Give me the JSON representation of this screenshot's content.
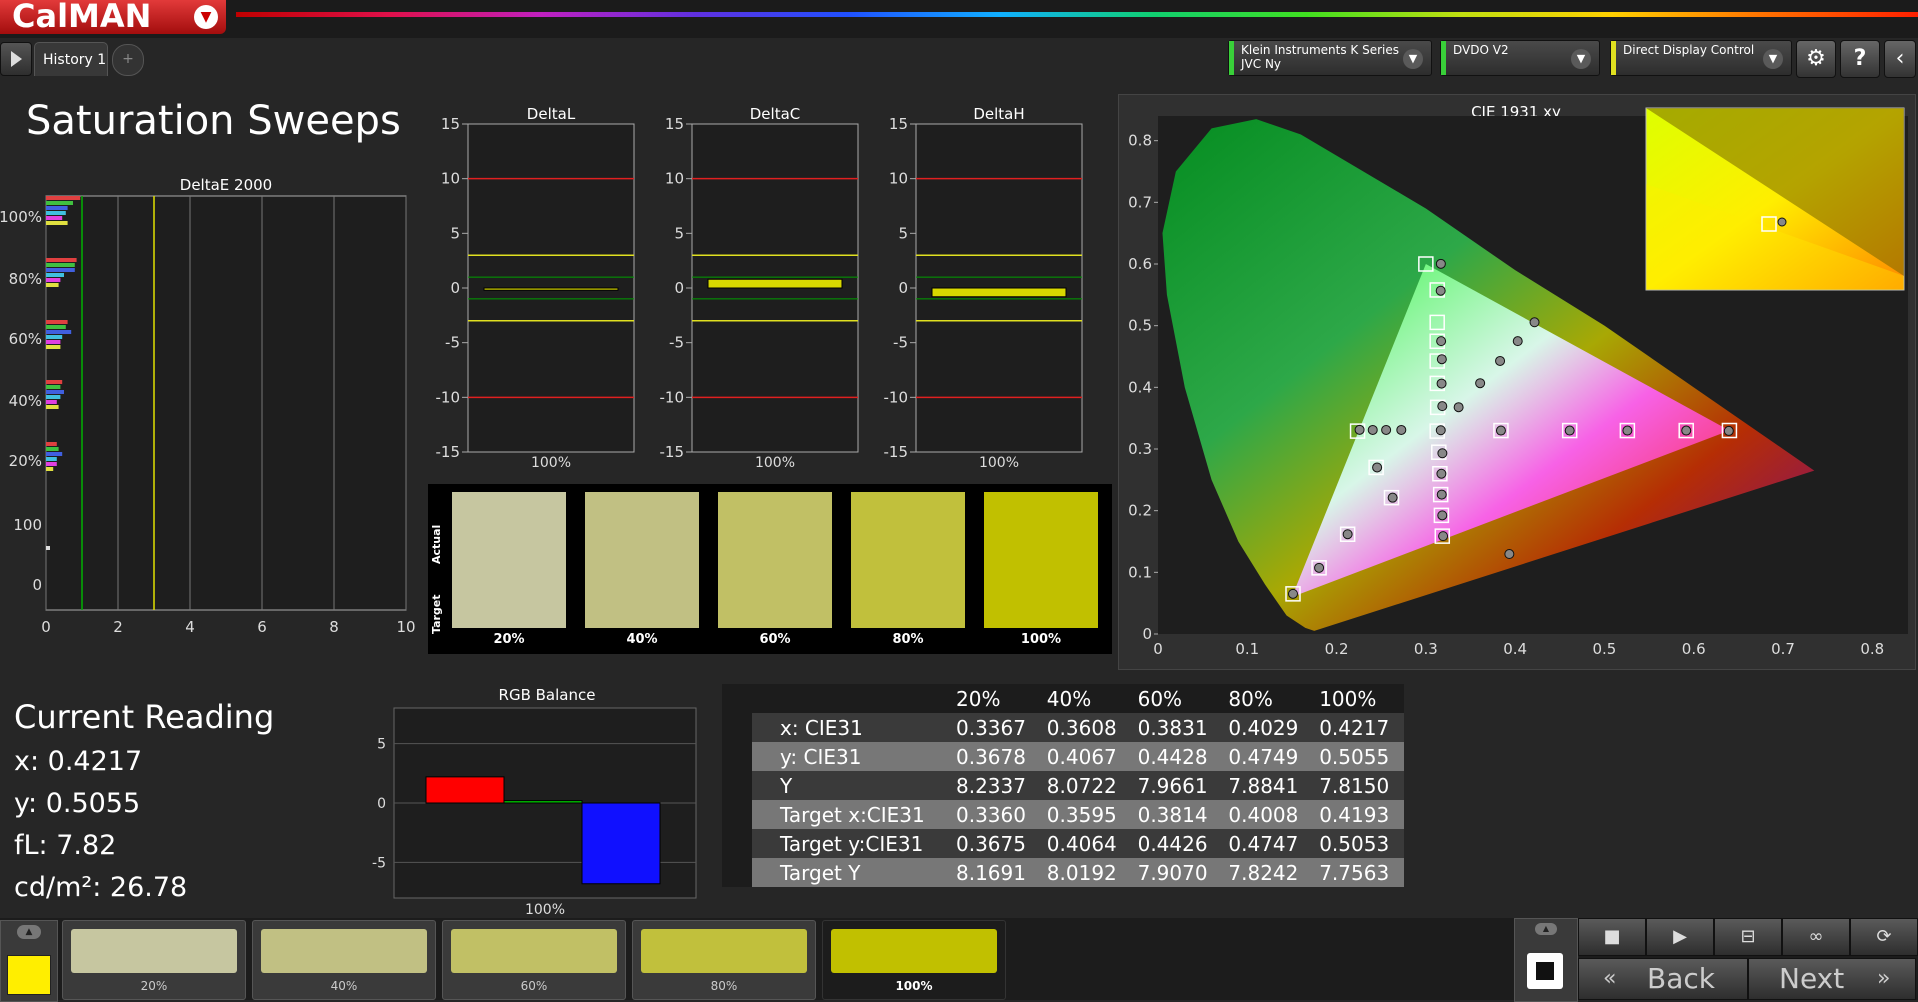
{
  "app": {
    "logo_text": "CalMAN",
    "logo_arrow": "▼"
  },
  "tabs": {
    "history_label": "History 1",
    "add_label": "+"
  },
  "devices": [
    {
      "line1": "Klein Instruments K Series",
      "line2": "JVC Ny",
      "color": "#39d039"
    },
    {
      "line1": "DVDO V2",
      "line2": "",
      "color": "#39d039"
    },
    {
      "line1": "Direct Display Control",
      "line2": "",
      "color": "#e0e020"
    }
  ],
  "toolbar_icons": [
    "gear-icon",
    "help-icon",
    "collapse-icon"
  ],
  "page_title": "Saturation Sweeps",
  "deltae_chart": {
    "title": "DeltaE 2000",
    "xticks": [
      "0",
      "2",
      "4",
      "6",
      "8",
      "10"
    ],
    "yticks": [
      "100%",
      "80%",
      "60%",
      "40%",
      "20%",
      "100",
      "0"
    ],
    "thresholds": [
      1,
      3
    ],
    "threshold_colors": [
      "#00b000",
      "#e0e000"
    ],
    "groups": [
      {
        "label": "100%",
        "bars": [
          {
            "v": 0.95,
            "c": "#e04040"
          },
          {
            "v": 0.75,
            "c": "#40c040"
          },
          {
            "v": 0.6,
            "c": "#4060e0"
          },
          {
            "v": 0.55,
            "c": "#40c0e0"
          },
          {
            "v": 0.45,
            "c": "#e040e0"
          },
          {
            "v": 0.6,
            "c": "#e0e040"
          }
        ]
      },
      {
        "label": "80%",
        "bars": [
          {
            "v": 0.85,
            "c": "#e04040"
          },
          {
            "v": 0.8,
            "c": "#40c040"
          },
          {
            "v": 0.8,
            "c": "#4060e0"
          },
          {
            "v": 0.5,
            "c": "#40c0e0"
          },
          {
            "v": 0.4,
            "c": "#e040e0"
          },
          {
            "v": 0.35,
            "c": "#e0e040"
          }
        ]
      },
      {
        "label": "60%",
        "bars": [
          {
            "v": 0.6,
            "c": "#e04040"
          },
          {
            "v": 0.55,
            "c": "#40c040"
          },
          {
            "v": 0.7,
            "c": "#4060e0"
          },
          {
            "v": 0.45,
            "c": "#40c0e0"
          },
          {
            "v": 0.4,
            "c": "#e040e0"
          },
          {
            "v": 0.4,
            "c": "#e0e040"
          }
        ]
      },
      {
        "label": "40%",
        "bars": [
          {
            "v": 0.45,
            "c": "#e04040"
          },
          {
            "v": 0.4,
            "c": "#40c040"
          },
          {
            "v": 0.5,
            "c": "#4060e0"
          },
          {
            "v": 0.4,
            "c": "#40c0e0"
          },
          {
            "v": 0.3,
            "c": "#e040e0"
          },
          {
            "v": 0.35,
            "c": "#e0e040"
          }
        ]
      },
      {
        "label": "20%",
        "bars": [
          {
            "v": 0.3,
            "c": "#e04040"
          },
          {
            "v": 0.35,
            "c": "#40c040"
          },
          {
            "v": 0.45,
            "c": "#4060e0"
          },
          {
            "v": 0.3,
            "c": "#40c0e0"
          },
          {
            "v": 0.3,
            "c": "#e040e0"
          },
          {
            "v": 0.2,
            "c": "#e0e040"
          }
        ]
      }
    ]
  },
  "delta_charts": [
    {
      "title": "DeltaL",
      "xlabel": "100%",
      "value": -0.2,
      "yticks": [
        "15",
        "10",
        "5",
        "0",
        "-5",
        "-10",
        "-15"
      ]
    },
    {
      "title": "DeltaC",
      "xlabel": "100%",
      "value": 0.8,
      "yticks": [
        "15",
        "10",
        "5",
        "0",
        "-5",
        "-10",
        "-15"
      ]
    },
    {
      "title": "DeltaH",
      "xlabel": "100%",
      "value": -0.8,
      "yticks": [
        "15",
        "10",
        "5",
        "0",
        "-5",
        "-10",
        "-15"
      ]
    }
  ],
  "swatch_panel": {
    "actual_label": "Actual",
    "target_label": "Target",
    "items": [
      {
        "label": "20%",
        "color": "#c6c6a0"
      },
      {
        "label": "40%",
        "color": "#c1c083"
      },
      {
        "label": "60%",
        "color": "#c1c065"
      },
      {
        "label": "80%",
        "color": "#c1c03c"
      },
      {
        "label": "100%",
        "color": "#c1c000"
      }
    ]
  },
  "cie": {
    "title": "CIE 1931 xy",
    "xticks": [
      "0",
      "0.1",
      "0.2",
      "0.3",
      "0.4",
      "0.5",
      "0.6",
      "0.7",
      "0.8"
    ],
    "yticks": [
      "0",
      "0.1",
      "0.2",
      "0.3",
      "0.4",
      "0.5",
      "0.6",
      "0.7",
      "0.8"
    ],
    "targets": [
      [
        0.3127,
        0.329
      ],
      [
        0.2235,
        0.329
      ],
      [
        0.2443,
        0.2701
      ],
      [
        0.2615,
        0.2211
      ],
      [
        0.2124,
        0.1618
      ],
      [
        0.1804,
        0.1073
      ],
      [
        0.1512,
        0.0651
      ],
      [
        0.3145,
        0.2948
      ],
      [
        0.3157,
        0.2599
      ],
      [
        0.3166,
        0.2261
      ],
      [
        0.3174,
        0.1924
      ],
      [
        0.3184,
        0.1587
      ],
      [
        0.3841,
        0.3299
      ],
      [
        0.4611,
        0.3299
      ],
      [
        0.5257,
        0.3299
      ],
      [
        0.5916,
        0.3299
      ],
      [
        0.64,
        0.33
      ],
      [
        0.3132,
        0.3675
      ],
      [
        0.3128,
        0.4064
      ],
      [
        0.3127,
        0.4426
      ],
      [
        0.3127,
        0.4747
      ],
      [
        0.3127,
        0.5053
      ],
      [
        0.3127,
        0.5579
      ],
      [
        0.3,
        0.6
      ]
    ],
    "measured": [
      [
        0.3167,
        0.3304
      ],
      [
        0.3367,
        0.3678
      ],
      [
        0.3608,
        0.4067
      ],
      [
        0.3831,
        0.4428
      ],
      [
        0.4029,
        0.4749
      ],
      [
        0.4217,
        0.5055
      ],
      [
        0.3184,
        0.3695
      ],
      [
        0.3176,
        0.4061
      ],
      [
        0.3179,
        0.4456
      ],
      [
        0.3171,
        0.4749
      ],
      [
        0.3166,
        0.5567
      ],
      [
        0.3168,
        0.6003
      ],
      [
        0.2258,
        0.3311
      ],
      [
        0.2405,
        0.3309
      ],
      [
        0.2555,
        0.3309
      ],
      [
        0.2725,
        0.3309
      ],
      [
        0.3185,
        0.2931
      ],
      [
        0.3174,
        0.2599
      ],
      [
        0.3178,
        0.2261
      ],
      [
        0.3184,
        0.1924
      ],
      [
        0.3193,
        0.1587
      ],
      [
        0.3841,
        0.3299
      ],
      [
        0.4611,
        0.3299
      ],
      [
        0.5257,
        0.3299
      ],
      [
        0.5916,
        0.3299
      ],
      [
        0.6393,
        0.3293
      ],
      [
        0.2454,
        0.2701
      ],
      [
        0.2628,
        0.2211
      ],
      [
        0.2124,
        0.1618
      ],
      [
        0.1804,
        0.1073
      ],
      [
        0.1512,
        0.0651
      ],
      [
        0.3935,
        0.1297
      ]
    ],
    "gamut": [
      [
        0.64,
        0.33
      ],
      [
        0.3,
        0.6
      ],
      [
        0.15,
        0.06
      ]
    ]
  },
  "current_reading": {
    "title": "Current Reading",
    "lines": [
      "x: 0.4217",
      "y: 0.5055",
      "fL: 7.82",
      "cd/m²: 26.78"
    ]
  },
  "rgb_balance": {
    "title": "RGB Balance",
    "xlabel": "100%",
    "yticks": [
      "5",
      "0",
      "-5"
    ],
    "values": {
      "r": 2.2,
      "g": 0.2,
      "b": -6.8
    }
  },
  "table": {
    "headers": [
      "",
      "20%",
      "40%",
      "60%",
      "80%",
      "100%"
    ],
    "rows": [
      [
        "x: CIE31",
        "0.3367",
        "0.3608",
        "0.3831",
        "0.4029",
        "0.4217"
      ],
      [
        "y: CIE31",
        "0.3678",
        "0.4067",
        "0.4428",
        "0.4749",
        "0.5055"
      ],
      [
        "Y",
        "8.2337",
        "8.0722",
        "7.9661",
        "7.8841",
        "7.8150"
      ],
      [
        "Target x:CIE31",
        "0.3360",
        "0.3595",
        "0.3814",
        "0.4008",
        "0.4193"
      ],
      [
        "Target y:CIE31",
        "0.3675",
        "0.4064",
        "0.4426",
        "0.4747",
        "0.5053"
      ],
      [
        "Target Y",
        "8.1691",
        "8.0192",
        "7.9070",
        "7.8242",
        "7.7563"
      ]
    ]
  },
  "bottom_swatches": [
    {
      "label": "20%",
      "color": "#c6c6a0"
    },
    {
      "label": "40%",
      "color": "#c1c083"
    },
    {
      "label": "60%",
      "color": "#c1c065"
    },
    {
      "label": "80%",
      "color": "#c1c03c"
    },
    {
      "label": "100%",
      "color": "#c1c000"
    }
  ],
  "current_color": "#ffee00",
  "nav": {
    "back_label": "Back",
    "next_label": "Next"
  },
  "transport_icons": [
    "stop-icon",
    "play-icon",
    "save-icon",
    "loop-icon",
    "refresh-icon"
  ]
}
